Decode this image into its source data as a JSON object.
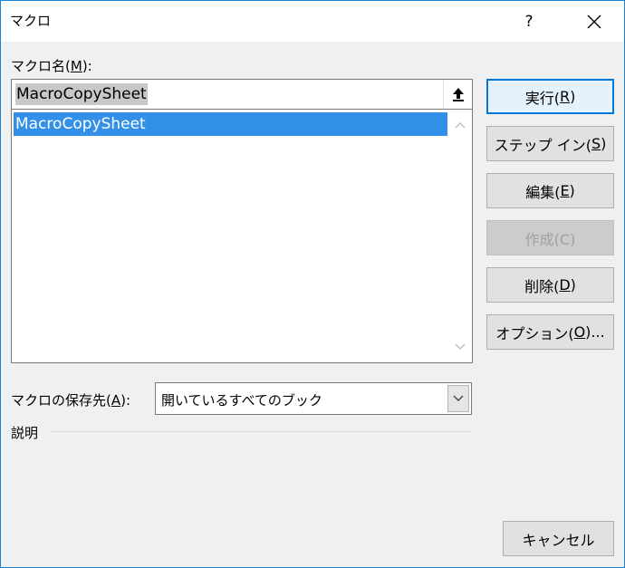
{
  "window": {
    "title": "マクロ",
    "help_label": "?"
  },
  "macro_name": {
    "label_prefix": "マクロ名(",
    "label_key": "M",
    "label_suffix": "):",
    "value": "MacroCopySheet"
  },
  "macro_list": {
    "items": [
      {
        "label": "MacroCopySheet",
        "selected": true
      }
    ]
  },
  "buttons": {
    "run": {
      "prefix": "実行(",
      "key": "R",
      "suffix": ")"
    },
    "step_into": {
      "prefix": "ステップ イン(",
      "key": "S",
      "suffix": ")"
    },
    "edit": {
      "prefix": "編集(",
      "key": "E",
      "suffix": ")"
    },
    "create": {
      "label": "作成(C)"
    },
    "delete": {
      "prefix": "削除(",
      "key": "D",
      "suffix": ")"
    },
    "options": {
      "prefix": "オプション(",
      "key": "O",
      "suffix": ")..."
    },
    "cancel": "キャンセル"
  },
  "location": {
    "label_prefix": "マクロの保存先(",
    "label_key": "A",
    "label_suffix": "):",
    "value": "開いているすべてのブック"
  },
  "description": {
    "label": "説明"
  },
  "colors": {
    "accent": "#0078d7",
    "selection": "#3390e8",
    "window_border": "#1883d7"
  }
}
